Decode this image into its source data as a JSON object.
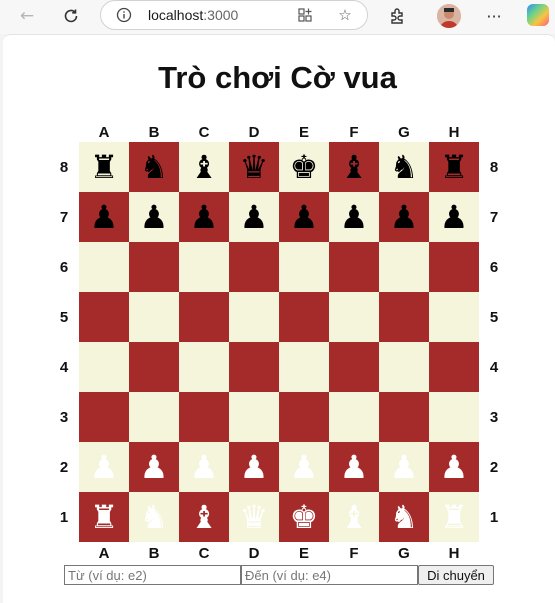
{
  "browser": {
    "url_host": "localhost",
    "url_port": ":3000",
    "icons": [
      "back-icon",
      "reload-icon",
      "info-icon",
      "apps-icon",
      "favorite-icon",
      "extensions-icon",
      "profile-avatar",
      "more-icon",
      "copilot-icon"
    ]
  },
  "page": {
    "title": "Trò chơi Cờ vua"
  },
  "board": {
    "files": [
      "A",
      "B",
      "C",
      "D",
      "E",
      "F",
      "G",
      "H"
    ],
    "ranks": [
      "8",
      "7",
      "6",
      "5",
      "4",
      "3",
      "2",
      "1"
    ],
    "colors": {
      "light": "#f5f5dc",
      "dark": "#a52a2a"
    },
    "position": [
      [
        "♜",
        "♞",
        "♝",
        "♛",
        "♚",
        "♝",
        "♞",
        "♜"
      ],
      [
        "♟",
        "♟",
        "♟",
        "♟",
        "♟",
        "♟",
        "♟",
        "♟"
      ],
      [
        "",
        "",
        "",
        "",
        "",
        "",
        "",
        ""
      ],
      [
        "",
        "",
        "",
        "",
        "",
        "",
        "",
        ""
      ],
      [
        "",
        "",
        "",
        "",
        "",
        "",
        "",
        ""
      ],
      [
        "",
        "",
        "",
        "",
        "",
        "",
        "",
        ""
      ],
      [
        "♟",
        "♟",
        "♟",
        "♟",
        "♟",
        "♟",
        "♟",
        "♟"
      ],
      [
        "♜",
        "♞",
        "♝",
        "♛",
        "♚",
        "♝",
        "♞",
        "♜"
      ]
    ],
    "piece_colors": [
      "black",
      "black",
      "",
      "",
      "",
      "",
      "white",
      "white"
    ]
  },
  "controls": {
    "from_placeholder": "Từ (ví dụ: e2)",
    "to_placeholder": "Đến (ví dụ: e4)",
    "move_button": "Di chuyển"
  }
}
